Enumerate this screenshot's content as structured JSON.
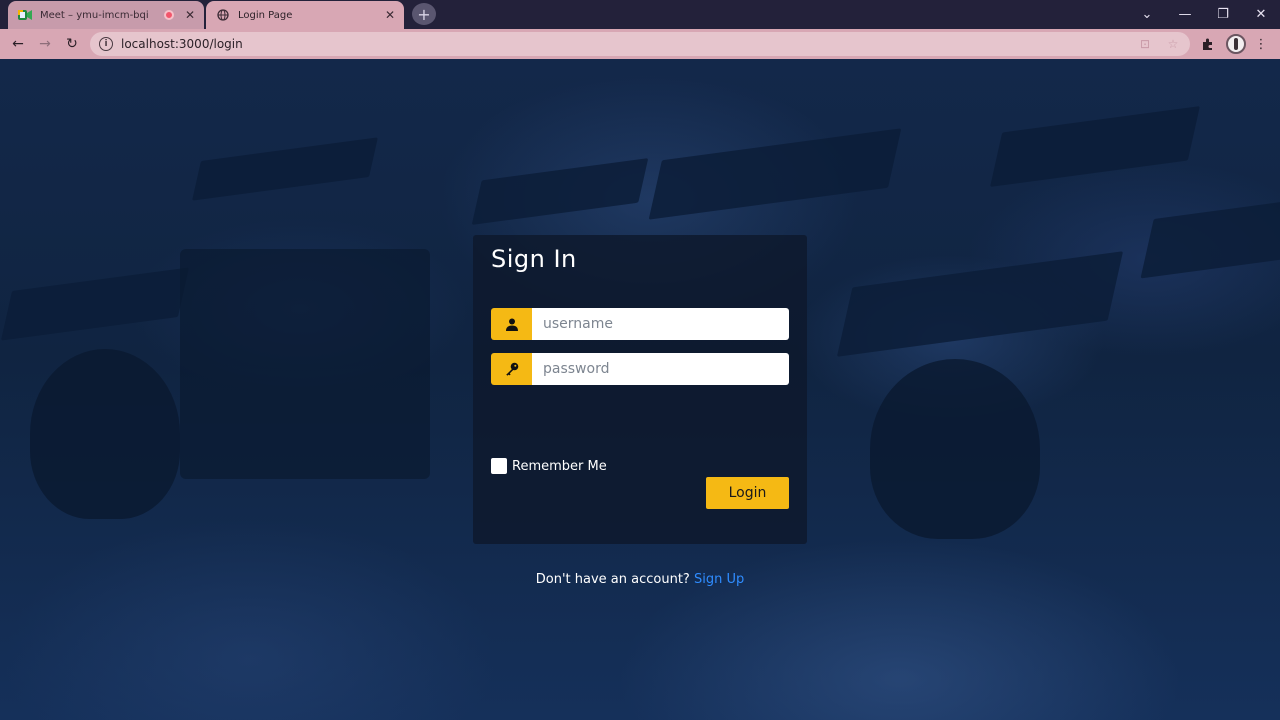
{
  "browser": {
    "tabs": [
      {
        "title": "Meet – ymu-imcm-bqi",
        "icon": "meet-icon",
        "recording": true
      },
      {
        "title": "Login Page",
        "icon": "globe-icon",
        "active": true
      }
    ],
    "address": "localhost:3000/login"
  },
  "login": {
    "title": "Sign In",
    "username_placeholder": "username",
    "password_placeholder": "password",
    "remember_label": "Remember Me",
    "login_label": "Login",
    "signup_prompt": "Don't have an account?",
    "signup_link": "Sign Up"
  },
  "colors": {
    "accent": "#f5b914",
    "link": "#2f8cff",
    "card_bg": "#0d182c"
  }
}
